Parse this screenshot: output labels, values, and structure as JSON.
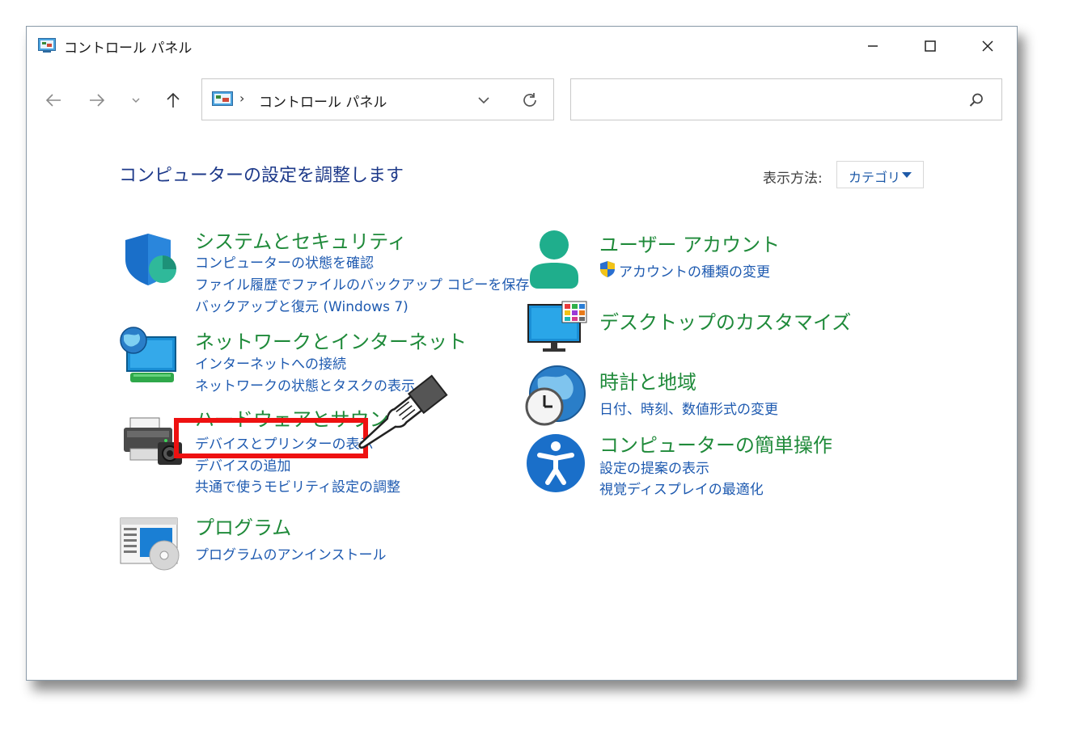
{
  "window": {
    "title": "コントロール パネル",
    "controls": {
      "minimize": "–",
      "maximize": "☐",
      "close": "✕"
    }
  },
  "nav": {
    "back_icon": "arrow-left-icon",
    "forward_icon": "arrow-right-icon",
    "recent_icon": "chevron-down-icon",
    "up_icon": "arrow-up-icon"
  },
  "address": {
    "separator": "›",
    "path": "コントロール パネル"
  },
  "search": {
    "placeholder": ""
  },
  "heading": "コンピューターの設定を調整します",
  "view": {
    "label": "表示方法:",
    "selected": "カテゴリ"
  },
  "categories_left": [
    {
      "title": "システムとセキュリティ",
      "links": [
        "コンピューターの状態を確認",
        "ファイル履歴でファイルのバックアップ コピーを保存",
        "バックアップと復元 (Windows 7)"
      ]
    },
    {
      "title": "ネットワークとインターネット",
      "links": [
        "インターネットへの接続",
        "ネットワークの状態とタスクの表示"
      ]
    },
    {
      "title": "ハードウェアとサウンド",
      "links": [
        "デバイスとプリンターの表示",
        "デバイスの追加",
        "共通で使うモビリティ設定の調整"
      ]
    },
    {
      "title": "プログラム",
      "links": [
        "プログラムのアンインストール"
      ]
    }
  ],
  "categories_right": [
    {
      "title": "ユーザー アカウント",
      "links": [
        "アカウントの種類の変更"
      ]
    },
    {
      "title": "デスクトップのカスタマイズ",
      "links": []
    },
    {
      "title": "時計と地域",
      "links": [
        "日付、時刻、数値形式の変更"
      ]
    },
    {
      "title": "コンピューターの簡単操作",
      "links": [
        "設定の提案の表示",
        "視覚ディスプレイの最適化"
      ]
    }
  ],
  "colors": {
    "heading": "#1e3a8a",
    "category_title": "#1f8a3a",
    "link": "#1e5ab0",
    "highlight": "#ee1111"
  }
}
